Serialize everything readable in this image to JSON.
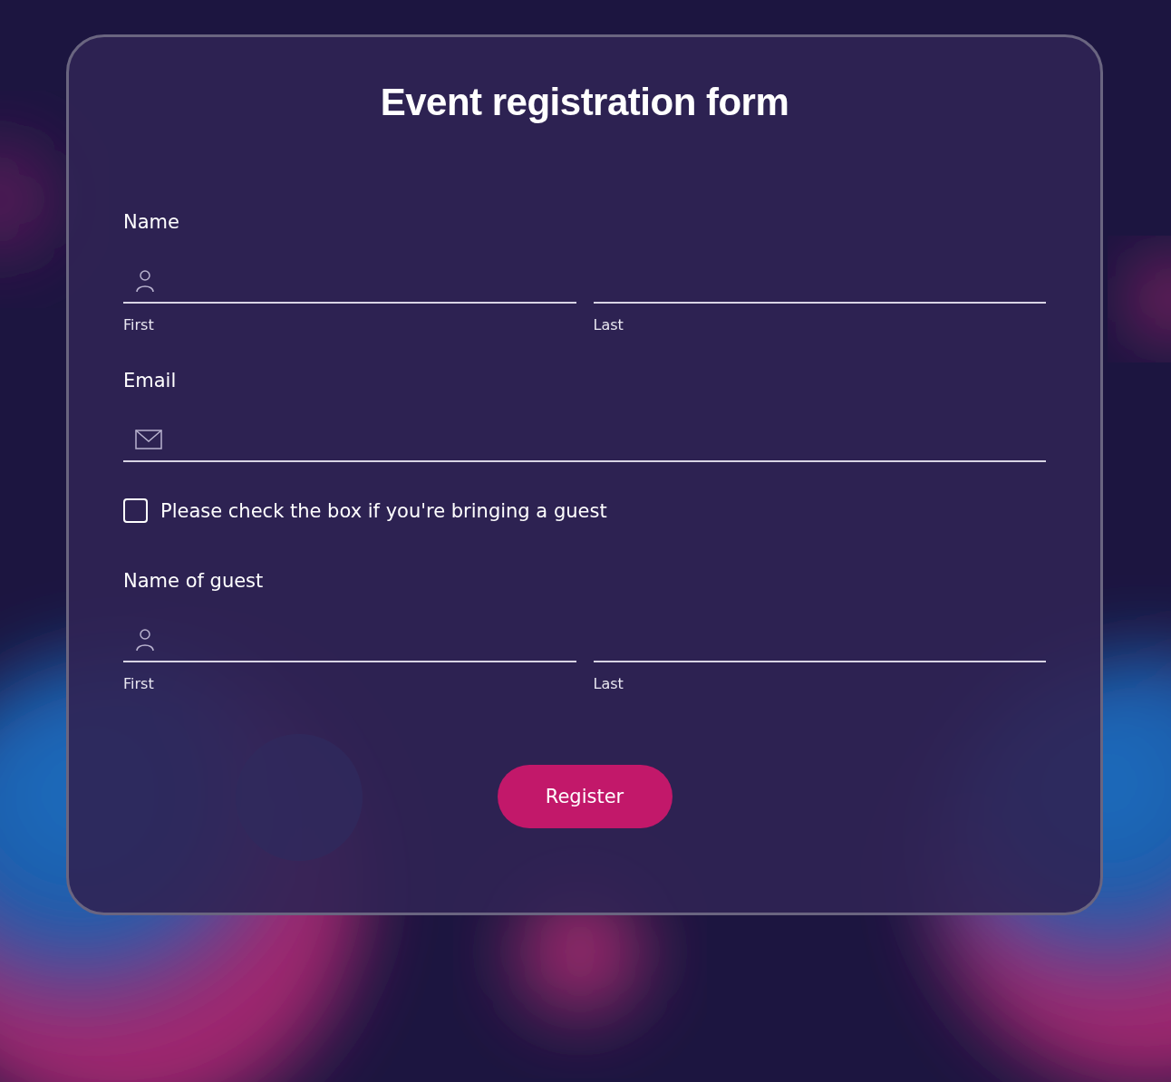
{
  "title": "Event registration form",
  "sections": [
    {
      "kind": "name",
      "label": "Name",
      "parts": [
        {
          "sublabel": "First"
        },
        {
          "sublabel": "Last"
        }
      ]
    },
    {
      "kind": "email",
      "label": "Email"
    },
    {
      "kind": "checkbox",
      "label": "Please check the box if you're bringing a guest",
      "checked": false
    },
    {
      "kind": "name",
      "label": "Name of guest",
      "parts": [
        {
          "sublabel": "First"
        },
        {
          "sublabel": "Last"
        }
      ]
    }
  ],
  "button": "Register"
}
